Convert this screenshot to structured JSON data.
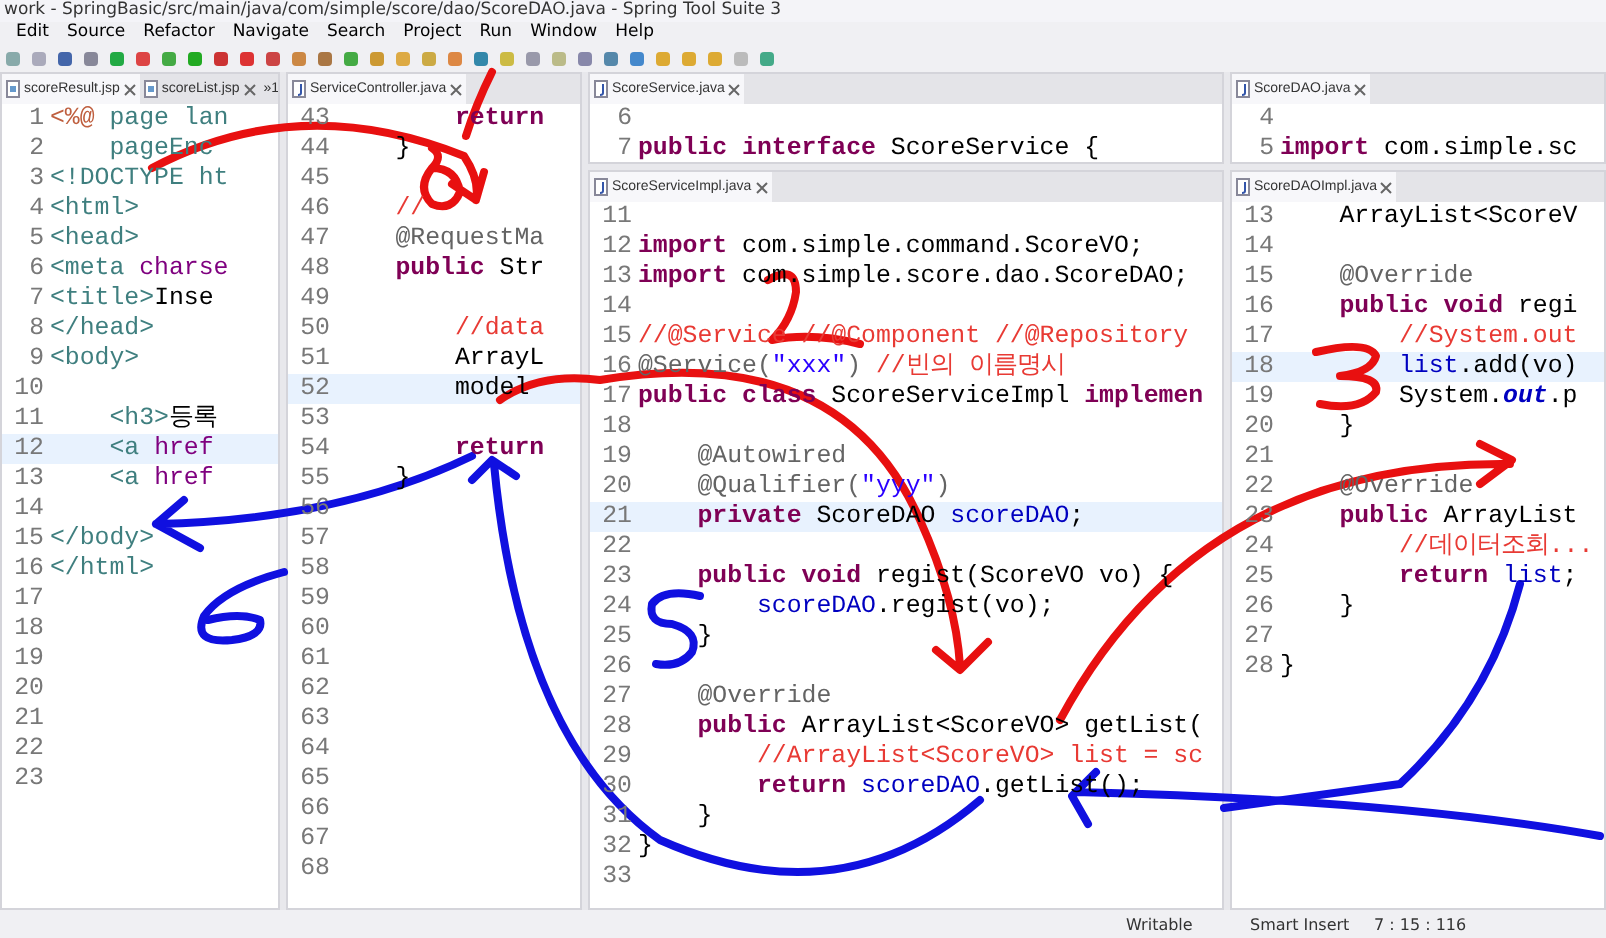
{
  "window": {
    "title": "work - SpringBasic/src/main/java/com/simple/score/dao/ScoreDAO.java - Spring Tool Suite 3"
  },
  "menu": [
    "Edit",
    "Source",
    "Refactor",
    "Navigate",
    "Search",
    "Project",
    "Run",
    "Window",
    "Help"
  ],
  "editors": [
    {
      "tabs": [
        {
          "label": "scoreResult.jsp",
          "kind": "jsp",
          "selected": true
        },
        {
          "label": "scoreList.jsp",
          "kind": "jsp",
          "selected": false
        }
      ],
      "more_tabs": "»1",
      "lines": [
        {
          "number": "1",
          "highlighted": false,
          "segments": [
            {
              "kind": "directive",
              "text": "<%@"
            },
            {
              "kind": "tag",
              "text": " page lan"
            }
          ]
        },
        {
          "number": "2",
          "highlighted": false,
          "segments": [
            {
              "kind": "tag",
              "text": "    pageEnc"
            }
          ]
        },
        {
          "number": "3",
          "highlighted": false,
          "segments": [
            {
              "kind": "tag",
              "text": "<!DOCTYPE ht"
            }
          ]
        },
        {
          "number": "4",
          "highlighted": false,
          "segments": [
            {
              "kind": "tag",
              "text": "<html>"
            }
          ]
        },
        {
          "number": "5",
          "highlighted": false,
          "segments": [
            {
              "kind": "tag",
              "text": "<head>"
            }
          ]
        },
        {
          "number": "6",
          "highlighted": false,
          "segments": [
            {
              "kind": "tag",
              "text": "<meta "
            },
            {
              "kind": "attr",
              "text": "charse"
            }
          ]
        },
        {
          "number": "7",
          "highlighted": false,
          "segments": [
            {
              "kind": "tag",
              "text": "<title>"
            },
            {
              "kind": "plain",
              "text": "Inse"
            }
          ]
        },
        {
          "number": "8",
          "highlighted": false,
          "segments": [
            {
              "kind": "tag",
              "text": "</head>"
            }
          ]
        },
        {
          "number": "9",
          "highlighted": false,
          "segments": [
            {
              "kind": "tag",
              "text": "<body>"
            }
          ]
        },
        {
          "number": "10",
          "highlighted": false
        },
        {
          "number": "11",
          "highlighted": false,
          "segments": [
            {
              "kind": "tag",
              "text": "    <h3>"
            },
            {
              "kind": "plain",
              "text": "등록"
            }
          ]
        },
        {
          "number": "12",
          "highlighted": true,
          "segments": [
            {
              "kind": "tag",
              "text": "    <a "
            },
            {
              "kind": "attr",
              "text": "href"
            }
          ]
        },
        {
          "number": "13",
          "highlighted": false,
          "segments": [
            {
              "kind": "tag",
              "text": "    <a "
            },
            {
              "kind": "attr",
              "text": "href"
            }
          ]
        },
        {
          "number": "14",
          "highlighted": false
        },
        {
          "number": "15",
          "highlighted": false,
          "segments": [
            {
              "kind": "tag",
              "text": "</body>"
            }
          ]
        },
        {
          "number": "16",
          "highlighted": false,
          "segments": [
            {
              "kind": "tag",
              "text": "</html>"
            }
          ]
        },
        {
          "number": "17",
          "highlighted": false
        },
        {
          "number": "18",
          "highlighted": false
        },
        {
          "number": "19",
          "highlighted": false
        },
        {
          "number": "20",
          "highlighted": false
        },
        {
          "number": "21",
          "highlighted": false
        },
        {
          "number": "22",
          "highlighted": false
        },
        {
          "number": "23",
          "highlighted": false
        }
      ]
    },
    {
      "tabs": [
        {
          "label": "ServiceController.java",
          "kind": "java",
          "selected": true
        }
      ],
      "lines": [
        {
          "number": "43",
          "highlighted": false,
          "segments": [
            {
              "kind": "keyword",
              "text": "        return"
            }
          ]
        },
        {
          "number": "44",
          "highlighted": false,
          "segments": [
            {
              "kind": "plain",
              "text": "    }"
            }
          ]
        },
        {
          "number": "45",
          "highlighted": false
        },
        {
          "number": "46",
          "highlighted": false,
          "segments": [
            {
              "kind": "comment",
              "text": "    //"
            }
          ]
        },
        {
          "number": "47",
          "highlighted": false,
          "segments": [
            {
              "kind": "annotation",
              "text": "    @RequestMa"
            }
          ]
        },
        {
          "number": "48",
          "highlighted": false,
          "segments": [
            {
              "kind": "keyword",
              "text": "    public"
            },
            {
              "kind": "plain",
              "text": " Str"
            }
          ]
        },
        {
          "number": "49",
          "highlighted": false
        },
        {
          "number": "50",
          "highlighted": false,
          "segments": [
            {
              "kind": "comment",
              "text": "        //data"
            }
          ]
        },
        {
          "number": "51",
          "highlighted": false,
          "segments": [
            {
              "kind": "plain",
              "text": "        ArrayL"
            }
          ]
        },
        {
          "number": "52",
          "highlighted": true,
          "segments": [
            {
              "kind": "plain",
              "text": "        model"
            }
          ]
        },
        {
          "number": "53",
          "highlighted": false
        },
        {
          "number": "54",
          "highlighted": false,
          "segments": [
            {
              "kind": "keyword",
              "text": "        return"
            }
          ]
        },
        {
          "number": "55",
          "highlighted": false,
          "segments": [
            {
              "kind": "plain",
              "text": "    }"
            }
          ]
        },
        {
          "number": "56",
          "highlighted": false
        },
        {
          "number": "57",
          "highlighted": false
        },
        {
          "number": "58",
          "highlighted": false
        },
        {
          "number": "59",
          "highlighted": false
        },
        {
          "number": "60",
          "highlighted": false
        },
        {
          "number": "61",
          "highlighted": false
        },
        {
          "number": "62",
          "highlighted": false
        },
        {
          "number": "63",
          "highlighted": false
        },
        {
          "number": "64",
          "highlighted": false
        },
        {
          "number": "65",
          "highlighted": false
        },
        {
          "number": "66",
          "highlighted": false
        },
        {
          "number": "67",
          "highlighted": false
        },
        {
          "number": "68",
          "highlighted": false
        }
      ]
    },
    {
      "tabs": [
        {
          "label": "ScoreService.java",
          "kind": "java",
          "selected": true
        }
      ],
      "lines": [
        {
          "number": "6",
          "highlighted": false
        },
        {
          "number": "7",
          "highlighted": false,
          "segments": [
            {
              "kind": "keyword",
              "text": "public interface"
            },
            {
              "kind": "plain",
              "text": " ScoreService {"
            }
          ]
        }
      ]
    },
    {
      "tabs": [
        {
          "label": "ScoreDAO.java",
          "kind": "java",
          "selected": true
        }
      ],
      "lines": [
        {
          "number": "4",
          "highlighted": false
        },
        {
          "number": "5",
          "highlighted": false,
          "segments": [
            {
              "kind": "keyword",
              "text": "import"
            },
            {
              "kind": "plain",
              "text": " com.simple.sc"
            }
          ]
        }
      ]
    },
    {
      "tabs": [
        {
          "label": "ScoreServiceImpl.java",
          "kind": "java",
          "selected": true
        }
      ],
      "lines": [
        {
          "number": "11",
          "highlighted": false
        },
        {
          "number": "12",
          "highlighted": false,
          "segments": [
            {
              "kind": "keyword",
              "text": "import"
            },
            {
              "kind": "plain",
              "text": " com.simple.command.ScoreVO;"
            }
          ]
        },
        {
          "number": "13",
          "highlighted": false,
          "segments": [
            {
              "kind": "keyword",
              "text": "import"
            },
            {
              "kind": "plain",
              "text": " com.simple.score.dao.ScoreDAO;"
            }
          ]
        },
        {
          "number": "14",
          "highlighted": false
        },
        {
          "number": "15",
          "highlighted": false,
          "segments": [
            {
              "kind": "comment",
              "text": "//@Service //@Component //@Repository"
            }
          ]
        },
        {
          "number": "16",
          "highlighted": false,
          "segments": [
            {
              "kind": "annotation",
              "text": "@Service("
            },
            {
              "kind": "string",
              "text": "\"xxx\""
            },
            {
              "kind": "annotation",
              "text": ") "
            },
            {
              "kind": "comment",
              "text": "//빈의 이름명시"
            }
          ]
        },
        {
          "number": "17",
          "highlighted": false,
          "segments": [
            {
              "kind": "keyword",
              "text": "public class"
            },
            {
              "kind": "plain",
              "text": " ScoreServiceImpl "
            },
            {
              "kind": "keyword",
              "text": "implemen"
            }
          ]
        },
        {
          "number": "18",
          "highlighted": false
        },
        {
          "number": "19",
          "highlighted": false,
          "segments": [
            {
              "kind": "annotation",
              "text": "    @Autowired"
            }
          ]
        },
        {
          "number": "20",
          "highlighted": false,
          "segments": [
            {
              "kind": "annotation",
              "text": "    @Qualifier("
            },
            {
              "kind": "string",
              "text": "\"yyy\""
            },
            {
              "kind": "annotation",
              "text": ")"
            }
          ]
        },
        {
          "number": "21",
          "highlighted": true,
          "segments": [
            {
              "kind": "keyword",
              "text": "    private"
            },
            {
              "kind": "plain",
              "text": " ScoreDAO "
            },
            {
              "kind": "field",
              "text": "scoreDAO"
            },
            {
              "kind": "plain",
              "text": ";"
            }
          ]
        },
        {
          "number": "22",
          "highlighted": false
        },
        {
          "number": "23",
          "highlighted": false,
          "segments": [
            {
              "kind": "keyword",
              "text": "    public void"
            },
            {
              "kind": "plain",
              "text": " regist(ScoreVO vo) {"
            }
          ]
        },
        {
          "number": "24",
          "highlighted": false,
          "segments": [
            {
              "kind": "field",
              "text": "        scoreDAO"
            },
            {
              "kind": "plain",
              "text": ".regist(vo);"
            }
          ]
        },
        {
          "number": "25",
          "highlighted": false,
          "segments": [
            {
              "kind": "plain",
              "text": "    }"
            }
          ]
        },
        {
          "number": "26",
          "highlighted": false
        },
        {
          "number": "27",
          "highlighted": false,
          "segments": [
            {
              "kind": "annotation",
              "text": "    @Override"
            }
          ]
        },
        {
          "number": "28",
          "highlighted": false,
          "segments": [
            {
              "kind": "keyword",
              "text": "    public"
            },
            {
              "kind": "plain",
              "text": " ArrayList<ScoreVO> getList("
            }
          ]
        },
        {
          "number": "29",
          "highlighted": false,
          "segments": [
            {
              "kind": "comment",
              "text": "        //ArrayList<ScoreVO> list = sc"
            }
          ]
        },
        {
          "number": "30",
          "highlighted": false,
          "segments": [
            {
              "kind": "keyword",
              "text": "        return"
            },
            {
              "kind": "field",
              "text": " scoreDAO"
            },
            {
              "kind": "plain",
              "text": ".getList();"
            }
          ]
        },
        {
          "number": "31",
          "highlighted": false,
          "segments": [
            {
              "kind": "plain",
              "text": "    }"
            }
          ]
        },
        {
          "number": "32",
          "highlighted": false,
          "segments": [
            {
              "kind": "plain",
              "text": "}"
            }
          ]
        },
        {
          "number": "33",
          "highlighted": false
        }
      ]
    },
    {
      "tabs": [
        {
          "label": "ScoreDAOImpl.java",
          "kind": "java",
          "selected": true
        }
      ],
      "lines": [
        {
          "number": "13",
          "highlighted": false,
          "segments": [
            {
              "kind": "plain",
              "text": "    ArrayList<ScoreV"
            }
          ]
        },
        {
          "number": "14",
          "highlighted": false
        },
        {
          "number": "15",
          "highlighted": false,
          "segments": [
            {
              "kind": "annotation",
              "text": "    @Override"
            }
          ]
        },
        {
          "number": "16",
          "highlighted": false,
          "segments": [
            {
              "kind": "keyword",
              "text": "    public void"
            },
            {
              "kind": "plain",
              "text": " regi"
            }
          ]
        },
        {
          "number": "17",
          "highlighted": false,
          "segments": [
            {
              "kind": "comment",
              "text": "        //System.out"
            }
          ]
        },
        {
          "number": "18",
          "highlighted": true,
          "segments": [
            {
              "kind": "field",
              "text": "        list"
            },
            {
              "kind": "plain",
              "text": ".add(vo)"
            }
          ]
        },
        {
          "number": "19",
          "highlighted": false,
          "segments": [
            {
              "kind": "plain",
              "text": "        System."
            },
            {
              "kind": "static",
              "text": "out"
            },
            {
              "kind": "plain",
              "text": ".p"
            }
          ]
        },
        {
          "number": "20",
          "highlighted": false,
          "segments": [
            {
              "kind": "plain",
              "text": "    }"
            }
          ]
        },
        {
          "number": "21",
          "highlighted": false
        },
        {
          "number": "22",
          "highlighted": false,
          "segments": [
            {
              "kind": "annotation",
              "text": "    @Override"
            }
          ]
        },
        {
          "number": "23",
          "highlighted": false,
          "segments": [
            {
              "kind": "keyword",
              "text": "    public"
            },
            {
              "kind": "plain",
              "text": " ArrayList"
            }
          ]
        },
        {
          "number": "24",
          "highlighted": false,
          "segments": [
            {
              "kind": "comment",
              "text": "        //데이터조회..."
            }
          ]
        },
        {
          "number": "25",
          "highlighted": false,
          "segments": [
            {
              "kind": "keyword",
              "text": "        return"
            },
            {
              "kind": "field",
              "text": " list"
            },
            {
              "kind": "plain",
              "text": ";"
            }
          ]
        },
        {
          "number": "26",
          "highlighted": false,
          "segments": [
            {
              "kind": "plain",
              "text": "    }"
            }
          ]
        },
        {
          "number": "27",
          "highlighted": false
        },
        {
          "number": "28",
          "highlighted": false,
          "segments": [
            {
              "kind": "plain",
              "text": "}"
            }
          ]
        }
      ]
    }
  ],
  "status_bar": [
    "Writable",
    "Smart Insert",
    "7 : 15 : 116"
  ]
}
